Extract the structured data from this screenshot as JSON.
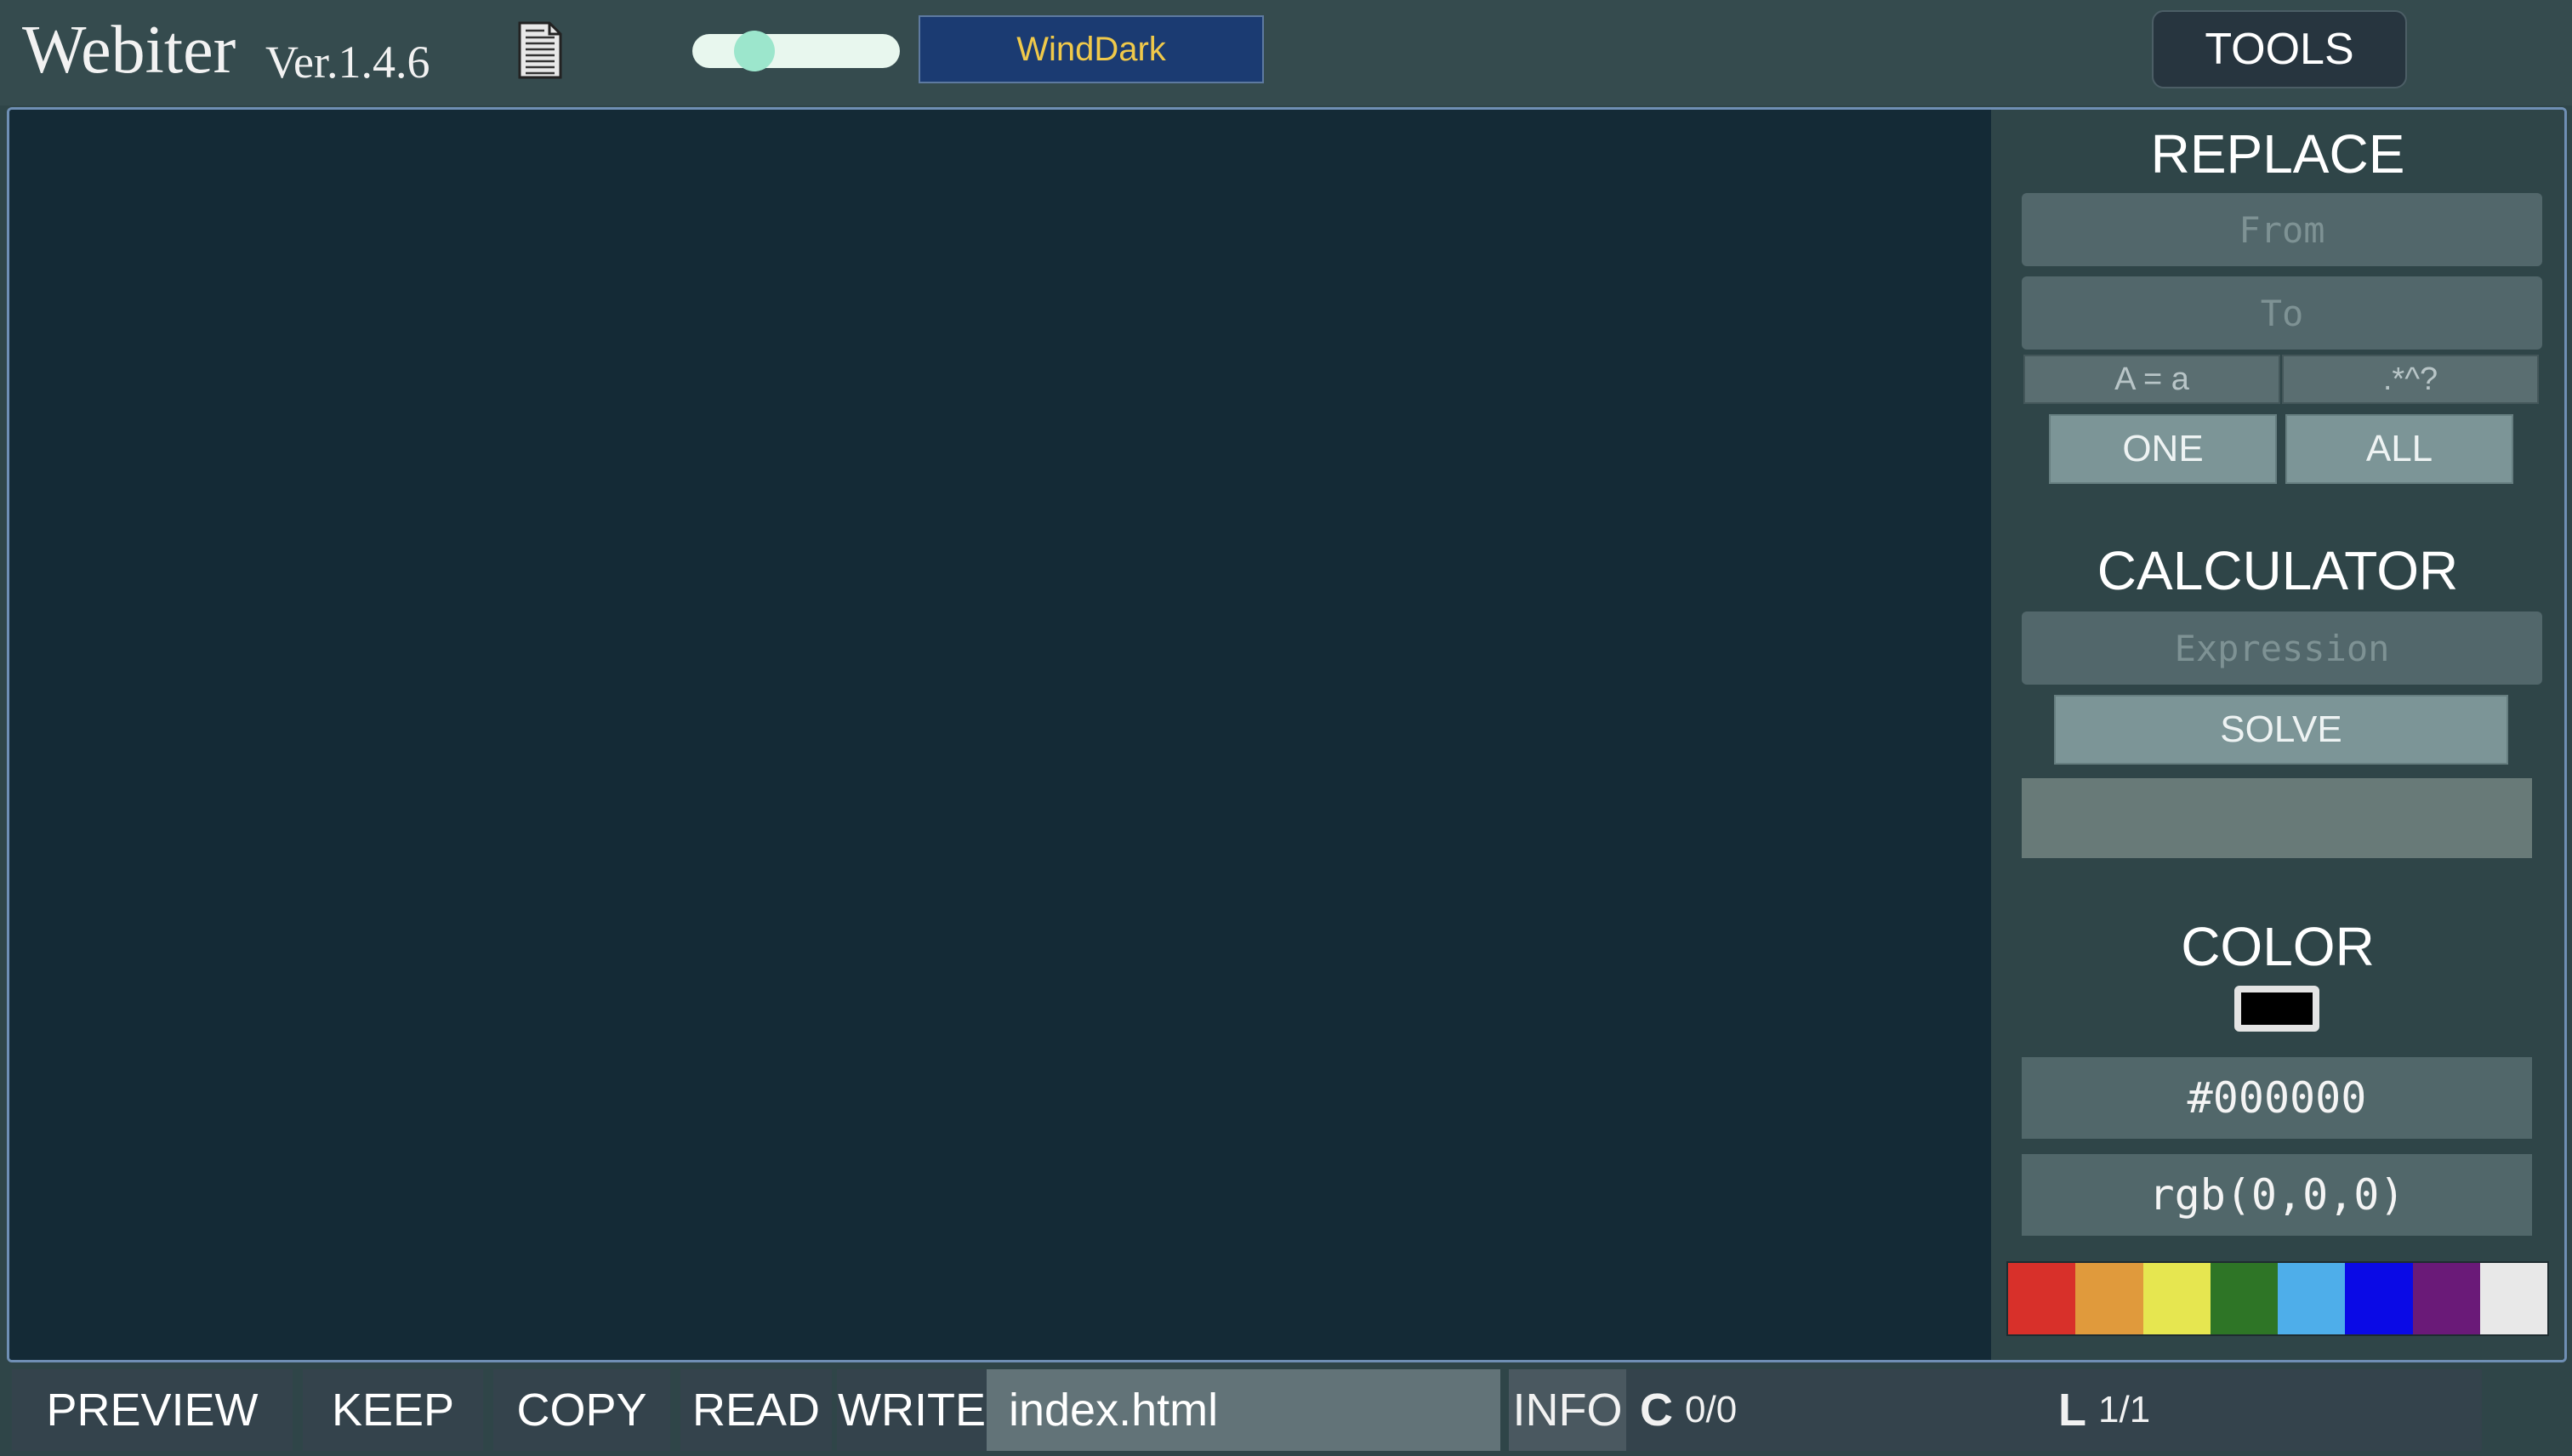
{
  "header": {
    "title": "Webiter",
    "version": "Ver.1.4.6",
    "doc_icon": "document-icon",
    "slider_value": 0.25,
    "theme": "WindDark",
    "tools_label": "TOOLS"
  },
  "replace": {
    "title": "REPLACE",
    "from_placeholder": "From",
    "to_placeholder": "To",
    "case_option": "A = a",
    "regex_option": ".*^?",
    "one_label": "ONE",
    "all_label": "ALL"
  },
  "calculator": {
    "title": "CALCULATOR",
    "expression_placeholder": "Expression",
    "solve_label": "SOLVE",
    "result": ""
  },
  "color": {
    "title": "COLOR",
    "hex": "#000000",
    "rgb": "rgb(0,0,0)",
    "swatch": "#000000",
    "palette": [
      "#d8302a",
      "#e09a3c",
      "#e6e650",
      "#2e7526",
      "#4eaeea",
      "#0a0ae6",
      "#6a1a78",
      "#e8e8e8"
    ]
  },
  "footer": {
    "preview_label": "PREVIEW",
    "keep_label": "KEEP",
    "copy_label": "COPY",
    "read_label": "READ",
    "write_label": "WRITE",
    "filename": "index.html",
    "info_label": "INFO",
    "char_label": "C",
    "char_value": "0/0",
    "line_label": "L",
    "line_value": "1/1"
  }
}
